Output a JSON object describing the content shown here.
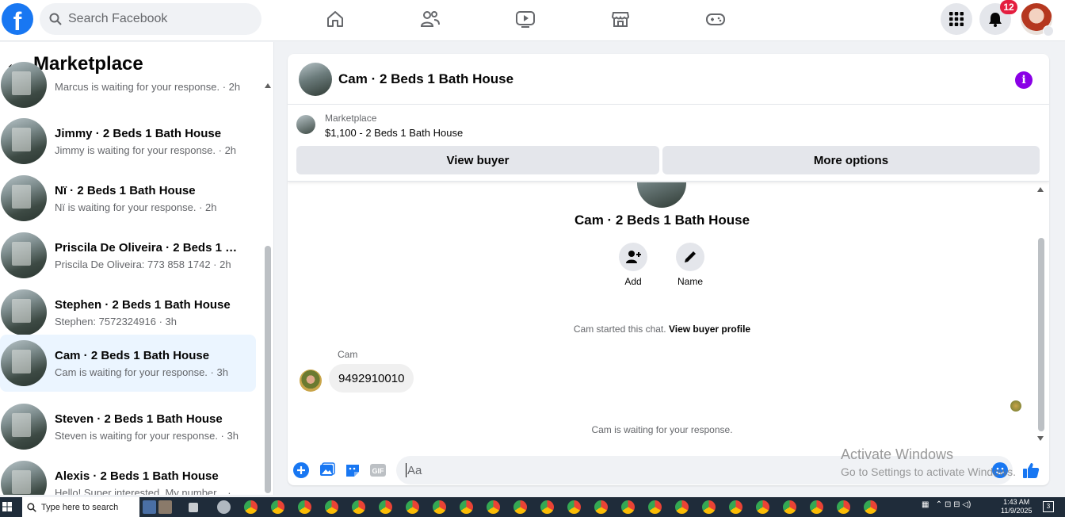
{
  "topbar": {
    "logo": "f",
    "search_placeholder": "Search Facebook",
    "nav_icons": [
      "home-icon",
      "friends-icon",
      "video-icon",
      "marketplace-icon",
      "gaming-icon"
    ],
    "notifications_count": "12"
  },
  "sidebar": {
    "back_arrow": "←",
    "title": "Marketplace",
    "conversations": [
      {
        "name": "",
        "sub": "Marcus is waiting for your response. · 2h"
      },
      {
        "name": "Jimmy · 2 Beds 1 Bath House",
        "sub": "Jimmy is waiting for your response. · 2h"
      },
      {
        "name": "Nï · 2 Beds 1 Bath House",
        "sub": "Nï is waiting for your response. · 2h"
      },
      {
        "name": "Priscila De Oliveira · 2 Beds 1 Bat...",
        "sub": "Priscila De Oliveira: 773 858 1742 · 2h"
      },
      {
        "name": "Stephen · 2 Beds 1 Bath House",
        "sub": "Stephen: 7572324916 · 3h"
      },
      {
        "name": "Cam · 2 Beds 1 Bath House",
        "sub": "Cam is waiting for your response. · 3h"
      },
      {
        "name": "Steven · 2 Beds 1 Bath House",
        "sub": "Steven is waiting for your response. · 3h"
      },
      {
        "name": "Alexis · 2 Beds 1 Bath House",
        "sub": "Hello! Super interested. My number... · 3h"
      }
    ]
  },
  "chat": {
    "title": "Cam · 2 Beds 1 Bath House",
    "info_glyph": "i",
    "marketplace_label": "Marketplace",
    "listing": "$1,100 - 2 Beds 1 Bath House",
    "view_buyer": "View buyer",
    "more_options": "More options",
    "center_name": "Cam · 2 Beds 1 Bath House",
    "add_label": "Add",
    "name_label": "Name",
    "started_text": "Cam started this chat.",
    "view_profile": "View buyer profile",
    "sender": "Cam",
    "message": "9492910010",
    "waiting_text": "Cam is waiting for your response.",
    "input_placeholder": "Aa"
  },
  "watermark": {
    "line1": "Activate Windows",
    "line2": "Go to Settings to activate Windows."
  },
  "taskbar": {
    "search_text": "Type here to search",
    "time": "1:43 AM",
    "date": "11/9/2025",
    "notif": "3"
  },
  "colors": {
    "brand": "#1877f2",
    "active_row": "#ebf5ff",
    "info": "#8a00e6",
    "badge": "#e41e3f"
  }
}
